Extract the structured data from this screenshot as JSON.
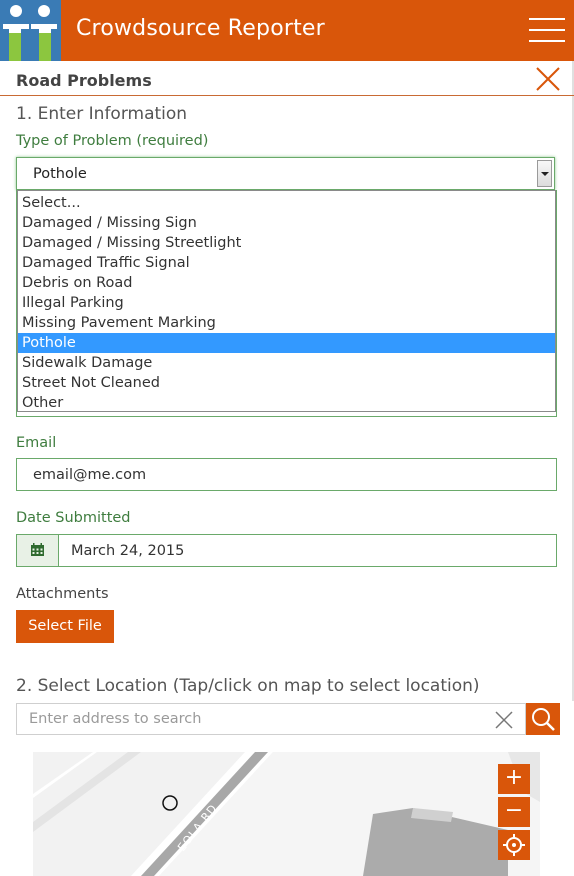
{
  "colors": {
    "accent": "#d9560a",
    "logo_bg": "#3a7bb5",
    "label_green": "#3f7d3f",
    "selection_blue": "#3399ff"
  },
  "app": {
    "title": "Crowdsource Reporter"
  },
  "panel": {
    "title": "Road Problems"
  },
  "step1": {
    "heading": "1. Enter Information"
  },
  "problem_type": {
    "label": "Type of Problem (required)",
    "value": "Pothole",
    "options": [
      "Select...",
      "Damaged / Missing Sign",
      "Damaged / Missing Streetlight",
      "Damaged Traffic Signal",
      "Debris on Road",
      "Illegal Parking",
      "Missing Pavement Marking",
      "Pothole",
      "Sidewalk Damage",
      "Street Not Cleaned",
      "Other"
    ],
    "selected_index": 7
  },
  "email": {
    "label": "Email",
    "value": "email@me.com"
  },
  "date": {
    "label": "Date Submitted",
    "value": "March 24, 2015",
    "icon": "calendar-icon"
  },
  "attachments": {
    "label": "Attachments",
    "button": "Select File"
  },
  "step2": {
    "heading": "2. Select Location (Tap/click on map to select location)"
  },
  "search": {
    "placeholder": "Enter address to search"
  },
  "map": {
    "road_label": "EOLA RD",
    "zoom_in": "+",
    "zoom_out": "−"
  }
}
